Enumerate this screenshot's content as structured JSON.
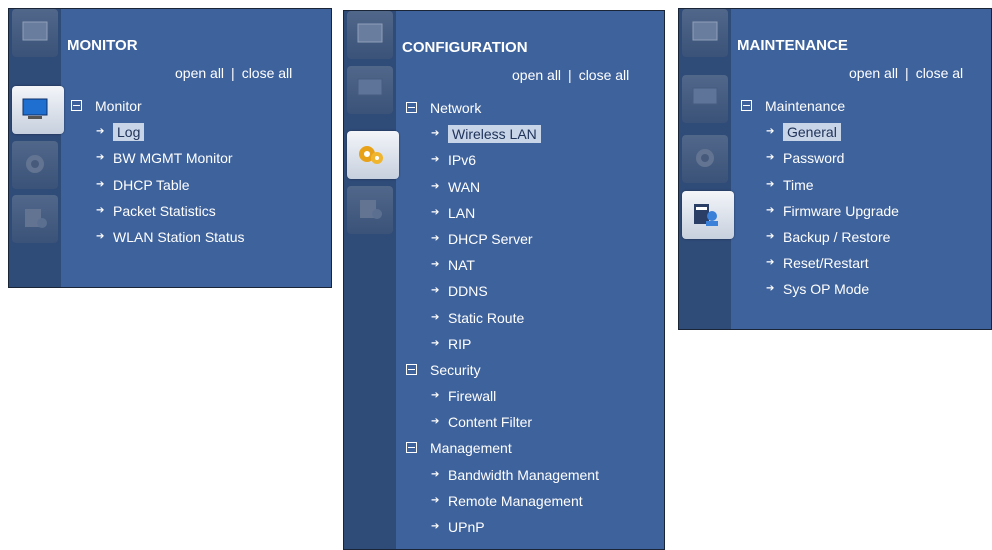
{
  "panels": [
    {
      "title": "MONITOR",
      "open_all": "open all",
      "separator": "|",
      "close_all": "close all",
      "active_tab": "monitor",
      "groups": [
        {
          "label": "Monitor",
          "items": [
            "Log",
            "BW MGMT Monitor",
            "DHCP Table",
            "Packet Statistics",
            "WLAN Station Status"
          ],
          "selected": "Log"
        }
      ]
    },
    {
      "title": "CONFIGURATION",
      "open_all": "open all",
      "separator": "|",
      "close_all": "close all",
      "active_tab": "configuration",
      "groups": [
        {
          "label": "Network",
          "items": [
            "Wireless LAN",
            "IPv6",
            "WAN",
            "LAN",
            "DHCP Server",
            "NAT",
            "DDNS",
            "Static Route",
            "RIP"
          ],
          "selected": "Wireless LAN"
        },
        {
          "label": "Security",
          "items": [
            "Firewall",
            "Content Filter"
          ]
        },
        {
          "label": "Management",
          "items": [
            "Bandwidth Management",
            "Remote Management",
            "UPnP"
          ]
        }
      ]
    },
    {
      "title": "MAINTENANCE",
      "open_all": "open all",
      "separator": "|",
      "close_all": "close al",
      "active_tab": "maintenance",
      "groups": [
        {
          "label": "Maintenance",
          "items": [
            "General",
            "Password",
            "Time",
            "Firmware Upgrade",
            "Backup / Restore",
            "Reset/Restart",
            "Sys OP Mode"
          ],
          "selected": "General"
        }
      ]
    }
  ],
  "tabs": [
    "status-icon",
    "monitor-icon",
    "configuration-icon",
    "maintenance-icon"
  ],
  "colors": {
    "panel_bg": "#3e629c",
    "tab_strip": "#2f4b78",
    "selected_bg": "#c8d4e8",
    "text": "#ffffff"
  }
}
